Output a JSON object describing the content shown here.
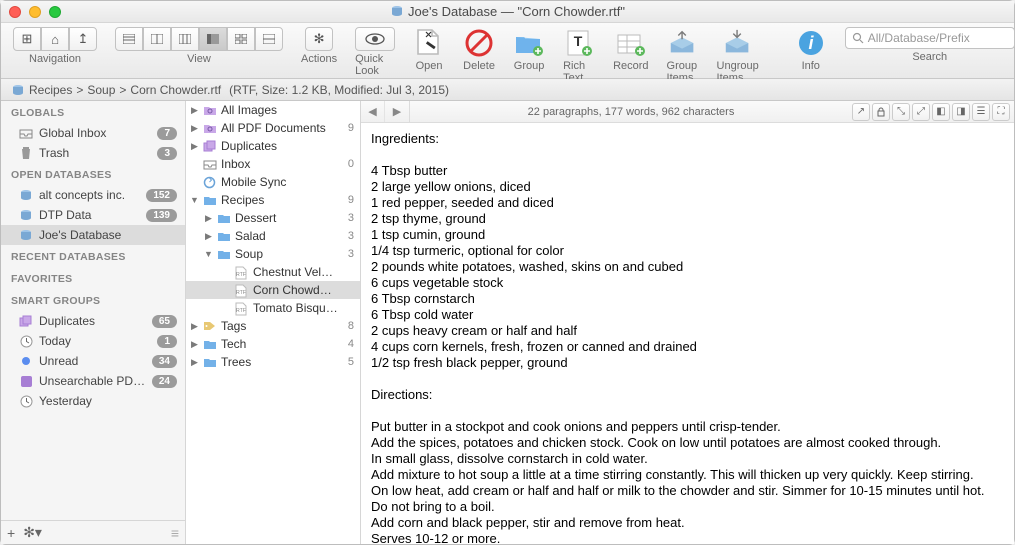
{
  "window": {
    "title": "Joe's Database — \"Corn Chowder.rtf\""
  },
  "toolbar": {
    "groups": {
      "navigation": "Navigation",
      "view": "View",
      "actions": "Actions",
      "quick_look": "Quick Look",
      "open": "Open",
      "delete": "Delete",
      "group": "Group",
      "rich_text": "Rich Text",
      "record": "Record",
      "group_items": "Group Items",
      "ungroup_items": "Ungroup Items",
      "info": "Info",
      "search": "Search"
    },
    "search_placeholder": "All/Database/Prefix"
  },
  "path": {
    "segments": [
      "Recipes",
      "Soup",
      "Corn Chowder.rtf"
    ],
    "meta": "(RTF, Size: 1.2 KB, Modified: Jul 3, 2015)"
  },
  "sidebar": {
    "sections": {
      "globals": "GLOBALS",
      "open_db": "OPEN DATABASES",
      "recent_db": "RECENT DATABASES",
      "favorites": "FAVORITES",
      "smart_groups": "SMART GROUPS"
    },
    "globals": [
      {
        "label": "Global Inbox",
        "badge": "7",
        "icon": "inbox"
      },
      {
        "label": "Trash",
        "badge": "3",
        "icon": "trash"
      }
    ],
    "open_db": [
      {
        "label": "alt concepts inc.",
        "badge": "152",
        "icon": "db"
      },
      {
        "label": "DTP Data",
        "badge": "139",
        "icon": "db"
      },
      {
        "label": "Joe's Database",
        "badge": "",
        "icon": "db",
        "selected": true
      }
    ],
    "smart_groups": [
      {
        "label": "Duplicates",
        "badge": "65",
        "icon": "dup"
      },
      {
        "label": "Today",
        "badge": "1",
        "icon": "clock"
      },
      {
        "label": "Unread",
        "badge": "34",
        "icon": "dot"
      },
      {
        "label": "Unsearchable PDFs",
        "badge": "24",
        "icon": "pdf"
      },
      {
        "label": "Yesterday",
        "badge": "",
        "icon": "clock"
      }
    ]
  },
  "browser": [
    {
      "label": "All Images",
      "tri": "right",
      "icon": "smart",
      "level": 0
    },
    {
      "label": "All PDF Documents",
      "tri": "right",
      "icon": "smart",
      "count": "9",
      "level": 0
    },
    {
      "label": "Duplicates",
      "tri": "right",
      "icon": "dup",
      "level": 0
    },
    {
      "label": "Inbox",
      "tri": "",
      "icon": "inbox",
      "count": "0",
      "level": 0
    },
    {
      "label": "Mobile Sync",
      "tri": "",
      "icon": "sync",
      "level": 0
    },
    {
      "label": "Recipes",
      "tri": "down",
      "icon": "folder-b",
      "count": "9",
      "level": 0,
      "selected": false
    },
    {
      "label": "Dessert",
      "tri": "right",
      "icon": "folder-b",
      "count": "3",
      "level": 1
    },
    {
      "label": "Salad",
      "tri": "right",
      "icon": "folder-b",
      "count": "3",
      "level": 1
    },
    {
      "label": "Soup",
      "tri": "down",
      "icon": "folder-b",
      "count": "3",
      "level": 1
    },
    {
      "label": "Chestnut Velouté.rtf",
      "tri": "",
      "icon": "rtf",
      "level": 2
    },
    {
      "label": "Corn Chowder.rtf",
      "tri": "",
      "icon": "rtf",
      "level": 2,
      "selected": true
    },
    {
      "label": "Tomato Bisque.rtf",
      "tri": "",
      "icon": "rtf",
      "level": 2
    },
    {
      "label": "Tags",
      "tri": "right",
      "icon": "tags",
      "count": "8",
      "level": 0
    },
    {
      "label": "Tech",
      "tri": "right",
      "icon": "folder-b",
      "count": "4",
      "level": 0
    },
    {
      "label": "Trees",
      "tri": "right",
      "icon": "folder-b",
      "count": "5",
      "level": 0
    }
  ],
  "content": {
    "stats": "22 paragraphs, 177 words, 962 characters",
    "body": "Ingredients:\n\n4 Tbsp butter\n2 large yellow onions, diced\n1 red pepper, seeded and diced\n2 tsp thyme, ground\n1 tsp cumin, ground\n1/4 tsp turmeric, optional for color\n2 pounds white potatoes, washed, skins on and cubed\n6 cups vegetable stock\n6 Tbsp cornstarch\n6 Tbsp cold water\n2 cups heavy cream or half and half\n4 cups corn kernels, fresh, frozen or canned and drained\n1/2 tsp fresh black pepper, ground\n\nDirections:\n\nPut butter in a stockpot and cook onions and peppers until crisp-tender.\nAdd the spices, potatoes and chicken stock. Cook on low until potatoes are almost cooked through.\nIn small glass, dissolve cornstarch in cold water.\nAdd mixture to hot soup a little at a time stirring constantly. This will thicken up very quickly. Keep stirring.\nOn low heat, add cream or half and half or milk to the chowder and stir. Simmer for 10-15 minutes until hot.\nDo not bring to a boil.\nAdd corn and black pepper, stir and remove from heat.\nServes 10-12 or more."
  }
}
